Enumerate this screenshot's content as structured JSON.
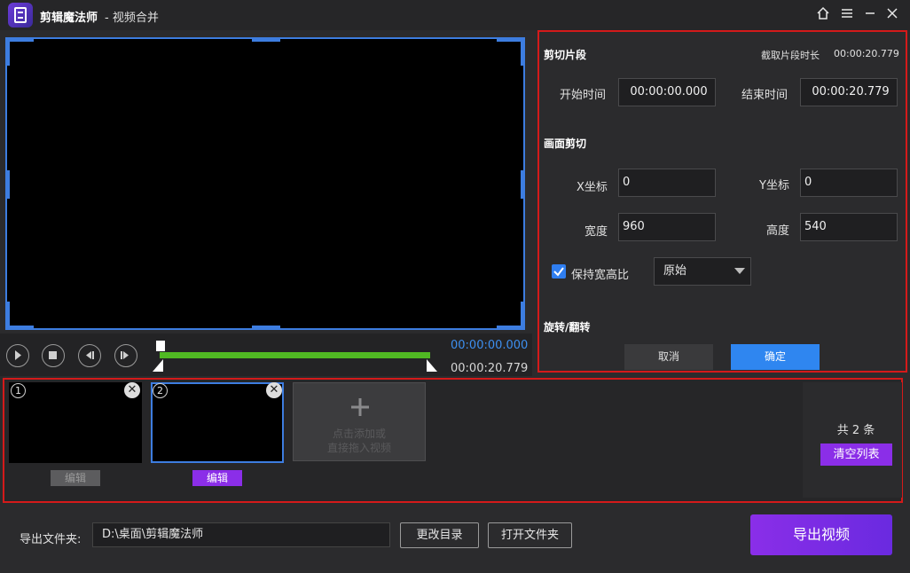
{
  "window": {
    "app_name": "剪辑魔法师",
    "subtitle": "- 视频合并"
  },
  "player": {
    "current_time": "00:00:00.000",
    "total_time": "00:00:20.779"
  },
  "cut_panel": {
    "segment_title": "剪切片段",
    "duration_label": "截取片段时长",
    "duration_value": "00:00:20.779",
    "start_label": "开始时间",
    "start_value": "00:00:00.000",
    "end_label": "结束时间",
    "end_value": "00:00:20.779",
    "crop_title": "画面剪切",
    "x_label": "X坐标",
    "x_value": "0",
    "y_label": "Y坐标",
    "y_value": "0",
    "width_label": "宽度",
    "width_value": "960",
    "height_label": "高度",
    "height_value": "540",
    "keep_ratio_label": "保持宽高比",
    "ratio_option": "原始",
    "rotate_title": "旋转/翻转",
    "cancel_label": "取消",
    "confirm_label": "确定"
  },
  "clips": {
    "items": [
      {
        "index": "1",
        "edit_label": "编辑"
      },
      {
        "index": "2",
        "edit_label": "编辑"
      }
    ],
    "add_hint_line1": "点击添加或",
    "add_hint_line2": "直接拖入视频",
    "count_label": "共 2 条",
    "clear_label": "清空列表"
  },
  "export": {
    "folder_label": "导出文件夹:",
    "folder_path": "D:\\桌面\\剪辑魔法师",
    "change_dir_label": "更改目录",
    "open_folder_label": "打开文件夹",
    "export_label": "导出视频"
  },
  "colors": {
    "accent_blue": "#2f86f0",
    "accent_purple": "#8b2ee8",
    "highlight_red": "#d41a1a",
    "timeline_green": "#50b823"
  }
}
